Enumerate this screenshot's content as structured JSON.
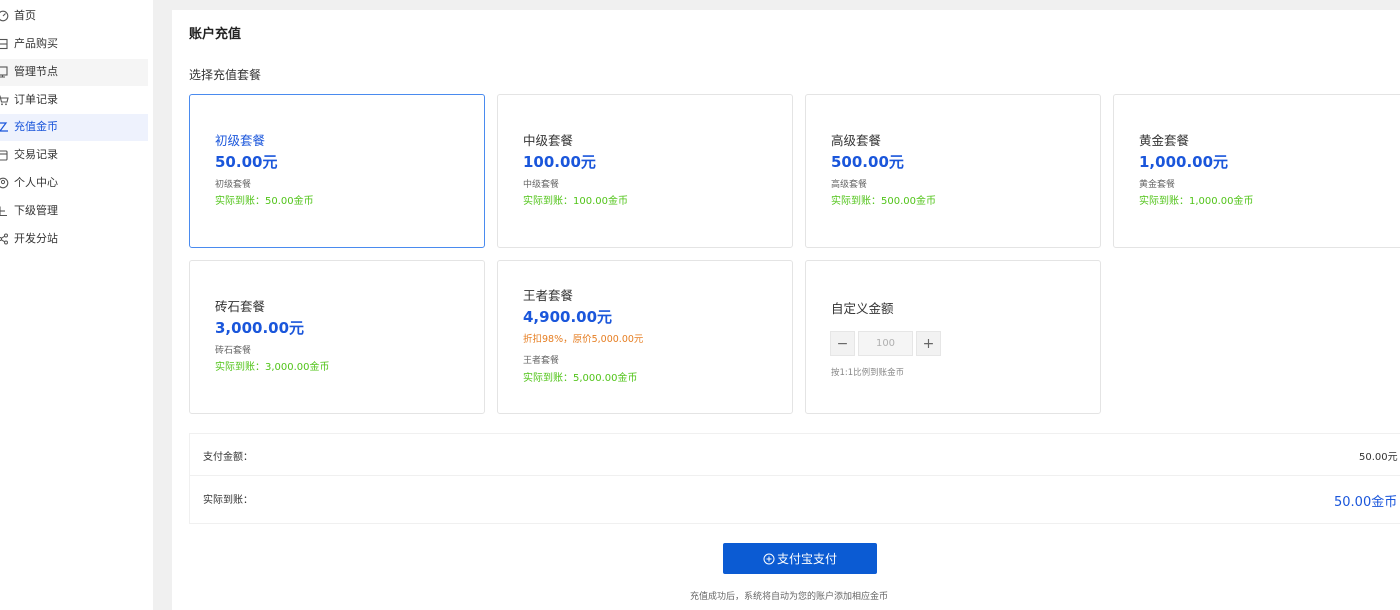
{
  "sidebar": {
    "items": [
      {
        "label": "首页",
        "icon": "dashboard-icon"
      },
      {
        "label": "产品购买",
        "icon": "product-icon"
      },
      {
        "label": "管理节点",
        "icon": "node-icon"
      },
      {
        "label": "订单记录",
        "icon": "cart-icon"
      },
      {
        "label": "充值金币",
        "icon": "recharge-icon"
      },
      {
        "label": "交易记录",
        "icon": "transaction-icon"
      },
      {
        "label": "个人中心",
        "icon": "user-icon"
      },
      {
        "label": "下级管理",
        "icon": "subordinate-icon"
      },
      {
        "label": "开发分站",
        "icon": "share-icon"
      }
    ]
  },
  "page": {
    "title": "账户充值",
    "section_title": "选择充值套餐"
  },
  "packages": [
    {
      "name": "初级套餐",
      "price": "50.00元",
      "sub": "初级套餐",
      "actual": "实际到账：50.00金币"
    },
    {
      "name": "中级套餐",
      "price": "100.00元",
      "sub": "中级套餐",
      "actual": "实际到账：100.00金币"
    },
    {
      "name": "高级套餐",
      "price": "500.00元",
      "sub": "高级套餐",
      "actual": "实际到账：500.00金币"
    },
    {
      "name": "黄金套餐",
      "price": "1,000.00元",
      "sub": "黄金套餐",
      "actual": "实际到账：1,000.00金币"
    },
    {
      "name": "砖石套餐",
      "price": "3,000.00元",
      "sub": "砖石套餐",
      "actual": "实际到账：3,000.00金币"
    },
    {
      "name": "王者套餐",
      "price": "4,900.00元",
      "discount": "折扣98%，原价5,000.00元",
      "sub": "王者套餐",
      "actual": "实际到账：5,000.00金币"
    }
  ],
  "custom": {
    "title": "自定义金额",
    "minus": "−",
    "plus": "+",
    "value": "100",
    "note": "按1:1比例到账金币"
  },
  "summary": {
    "pay_label": "支付金额：",
    "pay_value": "50.00元",
    "actual_label": "实际到账：",
    "actual_value": "50.00金币"
  },
  "pay_button": {
    "label": "支付宝支付"
  },
  "pay_note": "充值成功后，系统将自动为您的账户添加相应金币",
  "colors": {
    "accent": "#1a56db",
    "success": "#52c41a",
    "warning": "#e67e22"
  }
}
